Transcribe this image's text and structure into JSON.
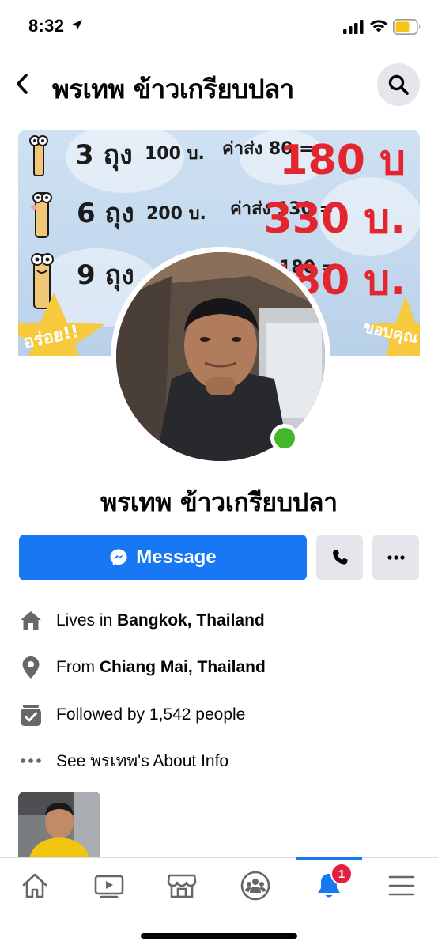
{
  "status_bar": {
    "time": "8:32",
    "location_icon": "location-arrow-icon",
    "signal_icon": "cellular-signal-icon",
    "wifi_icon": "wifi-icon",
    "battery_icon": "battery-icon"
  },
  "header": {
    "back_icon": "chevron-left-icon",
    "title": "พรเทพ ข้าวเกรียบปลา",
    "search_icon": "search-icon"
  },
  "cover": {
    "rows": [
      {
        "qty": "3 ถุง",
        "price_text": "100 บ.",
        "shipping": "ค่าส่ง 80 =",
        "total": "180 บ"
      },
      {
        "qty": "6 ถุง",
        "price_text": "200 บ.",
        "shipping": "ค่าส่ง 130 =",
        "total": "330 บ."
      },
      {
        "qty": "9 ถุง",
        "price_text": "",
        "shipping": "180 =",
        "total": "480 บ."
      }
    ],
    "left_star_text": "อร่อย!!",
    "right_star_text": "ขอบคุณ"
  },
  "profile": {
    "name": "พรเทพ ข้าวเกรียบปลา",
    "online": true
  },
  "actions": {
    "message_label": "Message",
    "message_icon": "messenger-icon",
    "call_icon": "phone-icon",
    "more_icon": "more-dots-icon"
  },
  "info": {
    "lives_prefix": "Lives in ",
    "lives_value": "Bangkok, Thailand",
    "from_prefix": "From ",
    "from_value": "Chiang Mai, Thailand",
    "followed": "Followed by 1,542 people",
    "see_about": "See พรเทพ's About Info"
  },
  "bottom_nav": {
    "items": [
      {
        "name": "home",
        "icon": "home-icon"
      },
      {
        "name": "watch",
        "icon": "video-icon"
      },
      {
        "name": "marketplace",
        "icon": "marketplace-icon"
      },
      {
        "name": "groups",
        "icon": "groups-icon"
      },
      {
        "name": "notifications",
        "icon": "bell-icon",
        "active": true
      },
      {
        "name": "menu",
        "icon": "hamburger-menu-icon"
      }
    ],
    "notification_badge": "1"
  },
  "colors": {
    "brand_blue": "#1877f2",
    "online_green": "#42b72a",
    "badge_red": "#e41e3f",
    "button_gray": "#e4e6eb"
  }
}
